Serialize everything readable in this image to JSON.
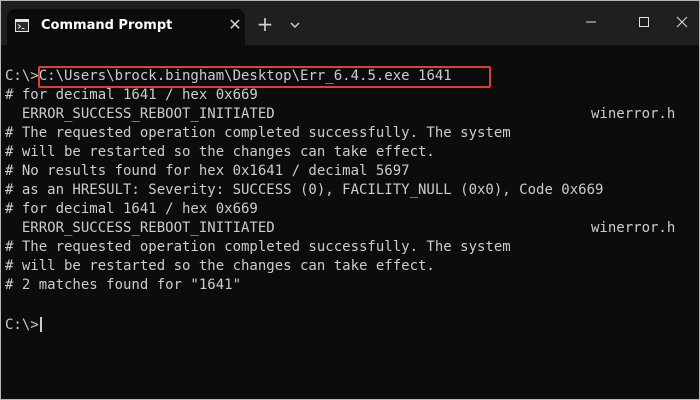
{
  "window": {
    "title": "Command Prompt",
    "new_tab_symbol": "+",
    "close_tab_symbol": "✕"
  },
  "console": {
    "prompt": "C:\\>",
    "command": "C:\\Users\\brock.bingham\\Desktop\\Err_6.4.5.exe 1641",
    "lines": [
      "# for decimal 1641 / hex 0x669",
      "  ERROR_SUCCESS_REBOOT_INITIATED",
      "# The requested operation completed successfully. The system",
      "# will be restarted so the changes can take effect.",
      "# No results found for hex 0x1641 / decimal 5697",
      "# as an HRESULT: Severity: SUCCESS (0), FACILITY_NULL (0x0), Code 0x669",
      "# for decimal 1641 / hex 0x669",
      "  ERROR_SUCCESS_REBOOT_INITIATED",
      "# The requested operation completed successfully. The system",
      "# will be restarted so the changes can take effect.",
      "# 2 matches found for \"1641\""
    ],
    "right_labels": {
      "first": "winerror.h",
      "second": "winerror.h"
    },
    "final_prompt": "C:\\>"
  },
  "colors": {
    "background": "#0c0c0c",
    "text": "#cccccc",
    "highlight_border": "#e03c3c",
    "titlebar": "#1f1f1f"
  }
}
